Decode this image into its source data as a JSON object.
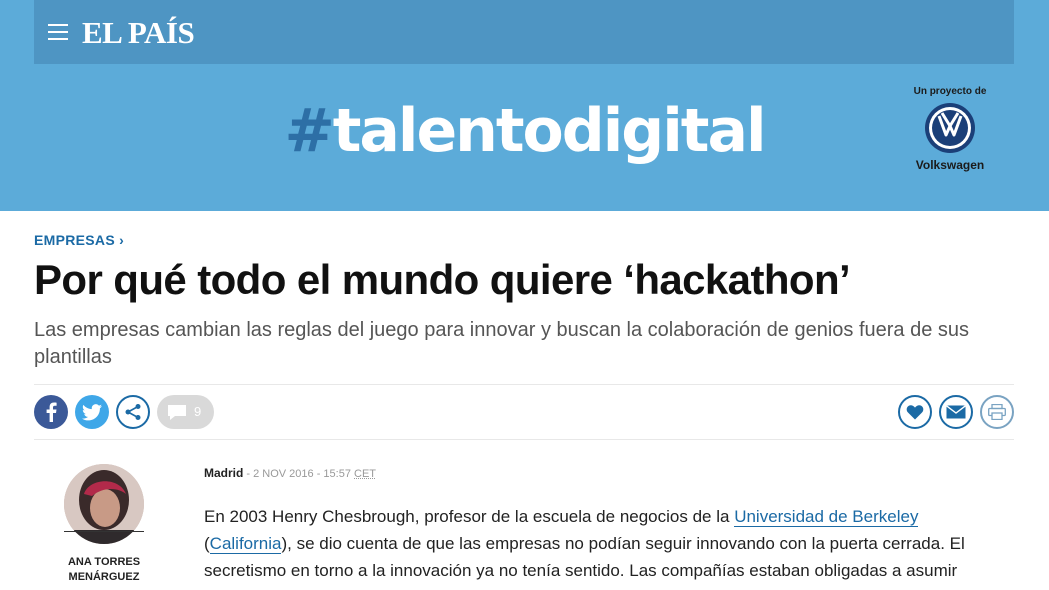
{
  "header": {
    "logo": "EL PAÍS",
    "menu_icon": "hamburger-menu-icon"
  },
  "banner": {
    "hash": "#",
    "word": "talentodigital",
    "sponsor_top": "Un proyecto de",
    "sponsor_name": "Volkswagen",
    "colors": {
      "banner": "#5cabd9",
      "topbar": "#4e95c3",
      "hash": "#2d6fa6"
    }
  },
  "article": {
    "section": "EMPRESAS ›",
    "headline": "Por qué todo el mundo quiere ‘hackathon’",
    "subtitle": "Las empresas cambian las reglas del juego para innovar y buscan la colaboración de genios fuera de sus plantillas",
    "comment_count": "9",
    "city": "Madrid",
    "date": " - 2 NOV 2016 - 15:57 ",
    "tz": "CET",
    "body": {
      "p1_a": "En 2003 Henry Chesbrough, profesor de la escuela de negocios de la ",
      "link1": "Universidad de Berkeley",
      "p1_b": " (",
      "link2": "California",
      "p1_c": "), se dio cuenta de que las empresas no podían seguir innovando con la puerta cerrada. El secretismo en torno a la innovación ya no tenía sentido. Las compañías estaban obligadas a asumir"
    }
  },
  "author": {
    "name": "ANA TORRES MENÁRGUEZ"
  },
  "share": {
    "icons": [
      "facebook-icon",
      "twitter-icon",
      "share-icon",
      "comment-icon",
      "heart-icon",
      "mail-icon",
      "print-icon"
    ],
    "colors": {
      "facebook": "#3b5998",
      "twitter": "#3fa7e8",
      "accent": "#1b6aa5"
    }
  }
}
